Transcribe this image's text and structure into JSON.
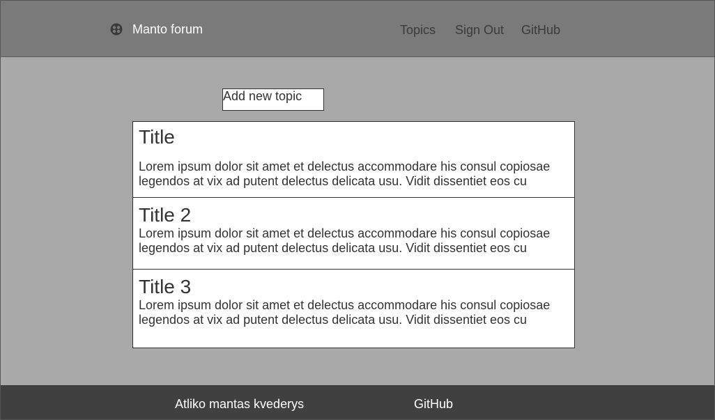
{
  "header": {
    "brand_icon": "forum-logo-icon",
    "brand_name": "Manto forum",
    "nav": {
      "topics": "Topics",
      "sign_out": "Sign Out",
      "github": "GitHub"
    }
  },
  "main": {
    "add_topic_label": "Add new topic",
    "topics": [
      {
        "title": "Title",
        "body": "Lorem ipsum dolor sit amet et delectus accommodare his consul copiosae legendos at vix ad putent delectus delicata usu. Vidit dissentiet eos cu"
      },
      {
        "title": "Title 2",
        "body": "Lorem ipsum dolor sit amet et delectus accommodare his consul copiosae legendos at vix ad putent delectus delicata usu. Vidit dissentiet eos cu"
      },
      {
        "title": "Title 3",
        "body": "Lorem ipsum dolor sit amet et delectus accommodare his consul copiosae legendos at vix ad putent delectus delicata usu. Vidit dissentiet eos cu"
      }
    ]
  },
  "footer": {
    "author": "Atliko mantas kvederys",
    "github": "GitHub"
  },
  "colors": {
    "header_bg": "#7a7a7a",
    "page_bg": "#a9a9a9",
    "footer_bg": "#404040",
    "card_bg": "#ffffff",
    "text_dark": "#333333"
  }
}
